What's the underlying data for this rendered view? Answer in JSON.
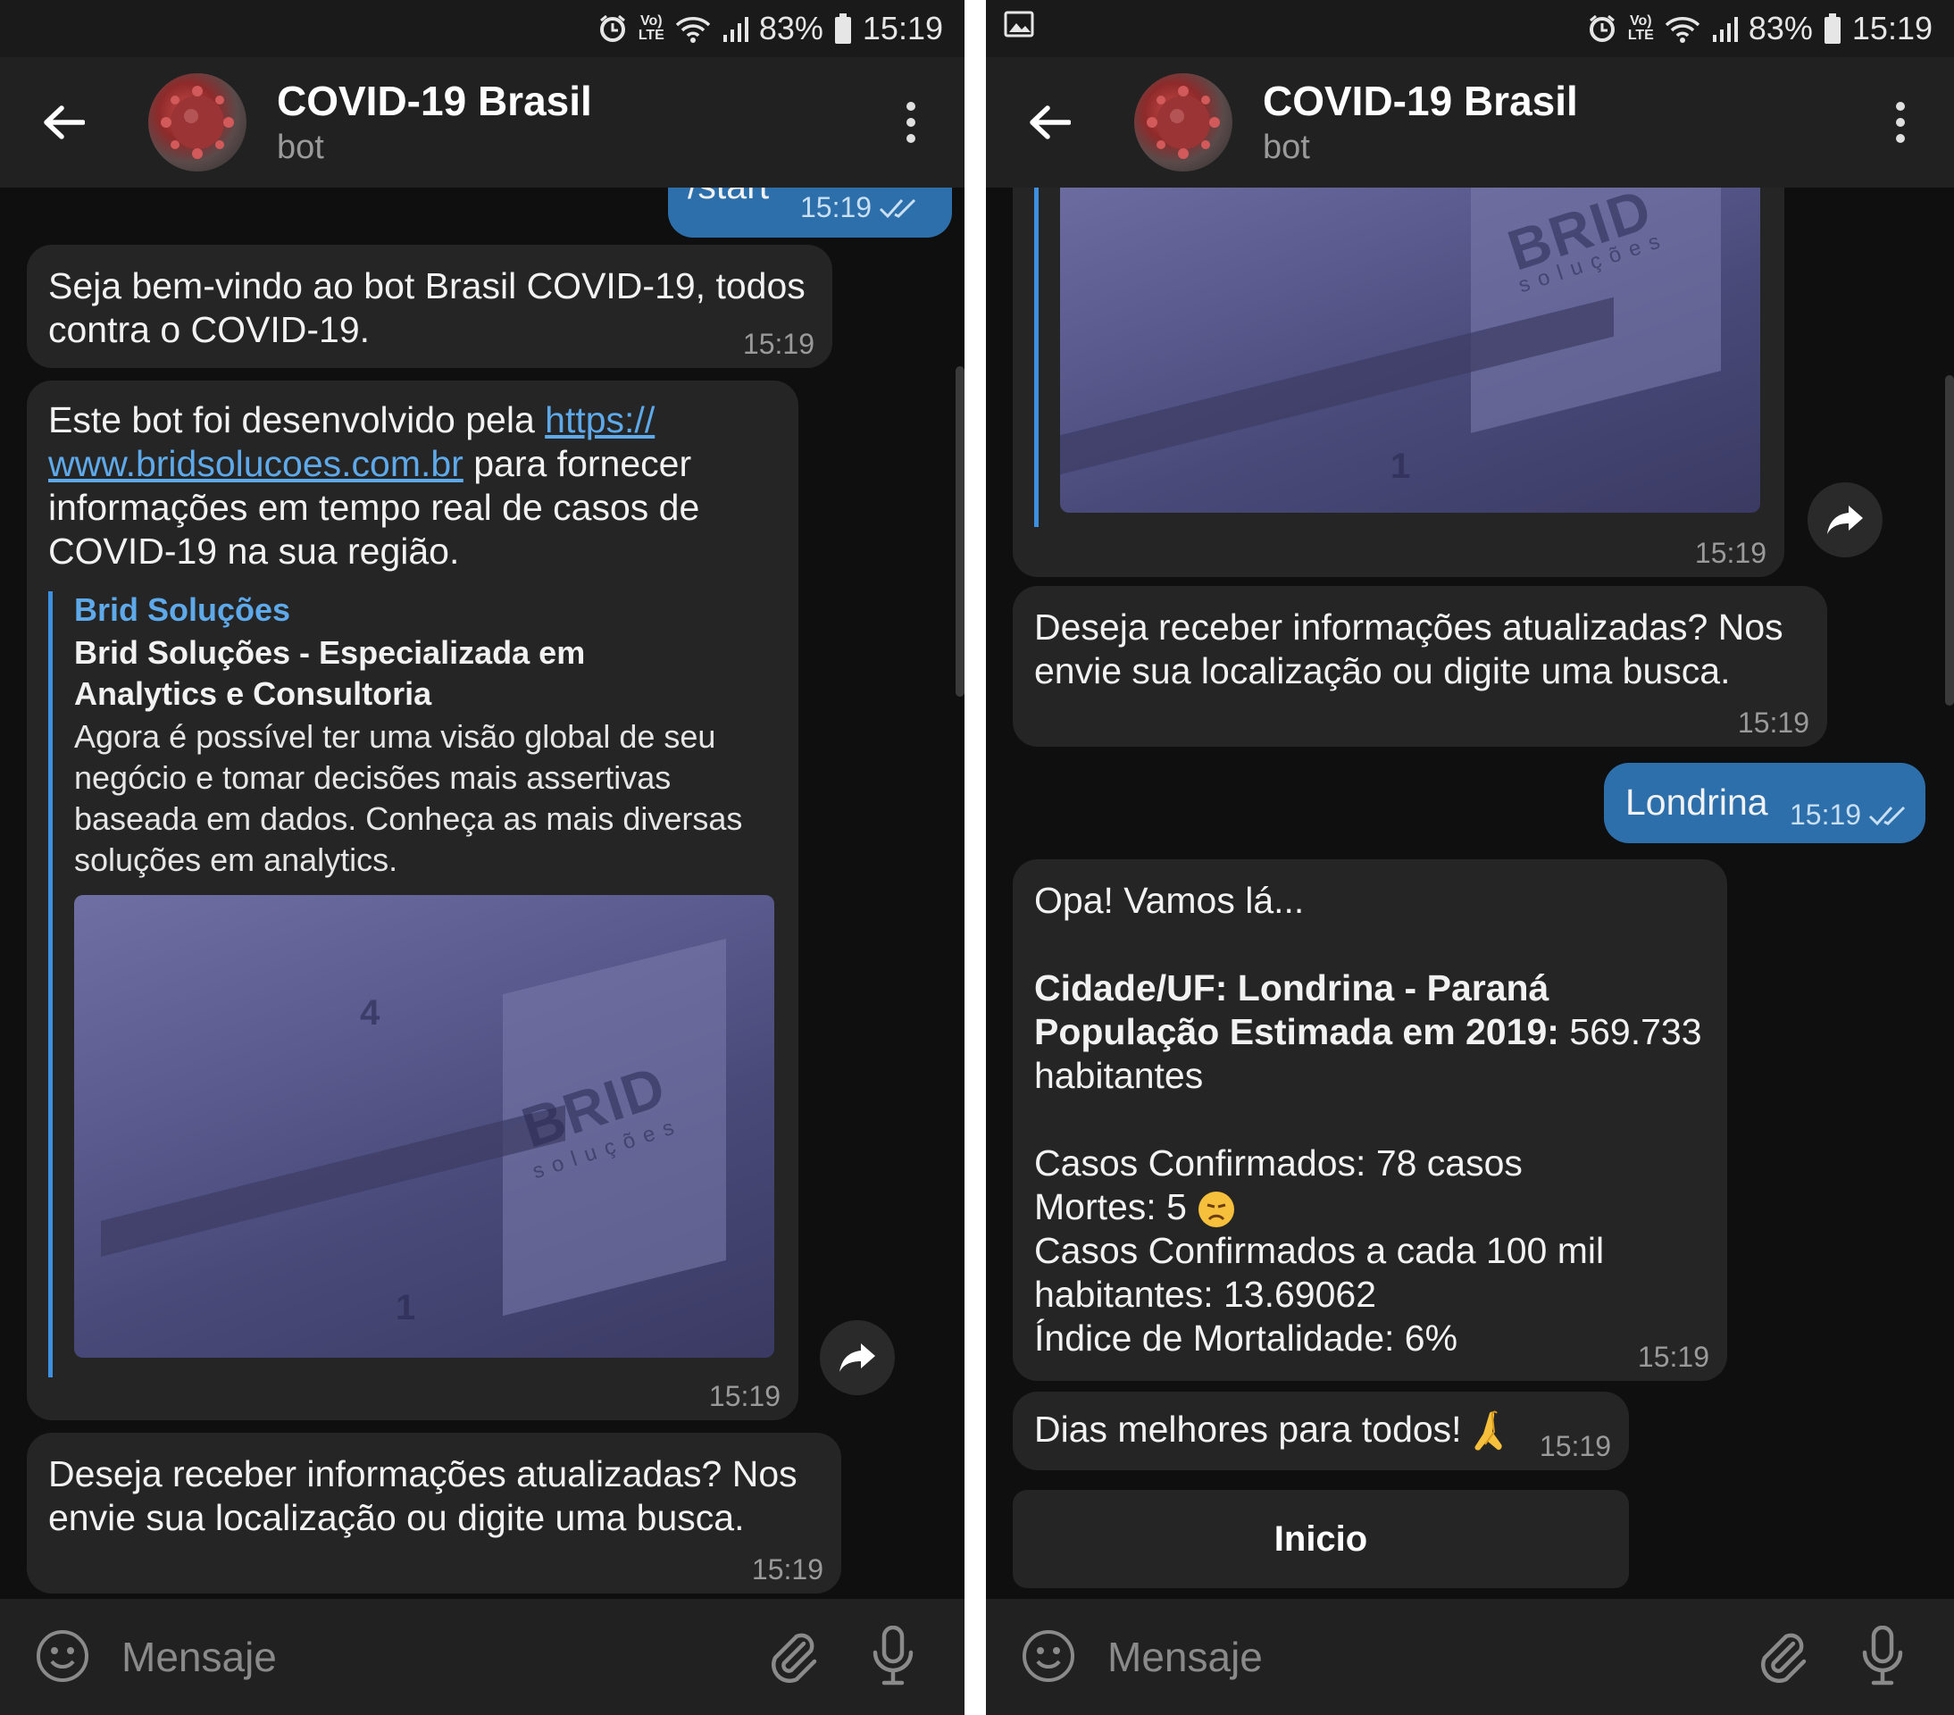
{
  "status": {
    "battery": "83%",
    "time": "15:19",
    "volte": "Vo)",
    "lte": "LTE"
  },
  "chat_header": {
    "title": "COVID-19 Brasil",
    "subtitle": "bot"
  },
  "input": {
    "placeholder": "Mensaje"
  },
  "left": {
    "start_cmd": {
      "text": "/start",
      "time": "15:19"
    },
    "welcome": {
      "text": "Seja bem-vindo ao bot Brasil COVID-19, todos contra o COVID-19.",
      "time": "15:19"
    },
    "about": {
      "before_link": "Este bot foi desenvolvido pela ",
      "link_line1": "https://",
      "link_line2": "www.bridsolucoes.com.br",
      "after_link": " para fornecer informações em tempo real de casos de COVID-19 na sua região.",
      "time": "15:19",
      "preview": {
        "site": "Brid Soluções",
        "title": "Brid Soluções - Especializada em Analytics e Consultoria",
        "description": "Agora é possível ter uma visão global de seu negócio e tomar decisões mais assertivas baseada em dados. Conheça as mais diversas soluções em analytics.",
        "image_logo": "BRID",
        "image_logo_sub": "soluções",
        "image_number_top": "4",
        "image_number_bottom": "1"
      }
    },
    "prompt": {
      "text": "Deseja receber informações atualizadas? Nos envie sua localização ou digite uma busca.",
      "time": "15:19"
    }
  },
  "right": {
    "image_msg": {
      "time": "15:19",
      "image_logo": "BRID",
      "image_logo_sub": "soluções",
      "image_number_bottom": "1"
    },
    "prompt": {
      "text": "Deseja receber informações atualizadas? Nos envie sua localização ou digite uma busca.",
      "time": "15:19"
    },
    "user_reply": {
      "text": "Londrina",
      "time": "15:19"
    },
    "result": {
      "greeting": "Opa! Vamos lá...",
      "city_label": "Cidade/UF:",
      "city_value": " Londrina - Paraná",
      "pop_label": "População Estimada em 2019:",
      "pop_value": " 569.733 habitantes",
      "confirmed": "Casos Confirmados: 78 casos",
      "deaths": "Mortes: 5",
      "per100k": "Casos Confirmados a cada 100 mil habitantes: 13.69062",
      "mortality": "Índice de Mortalidade: 6%",
      "time": "15:19"
    },
    "closing": {
      "text": "Dias melhores para todos!",
      "time": "15:19"
    },
    "keyboard_button": "Inicio"
  },
  "colors": {
    "bubble_in": "#252525",
    "bubble_out": "#2c6fab",
    "link": "#5ea9ea",
    "background": "#0f0f0f",
    "header": "#212121"
  }
}
